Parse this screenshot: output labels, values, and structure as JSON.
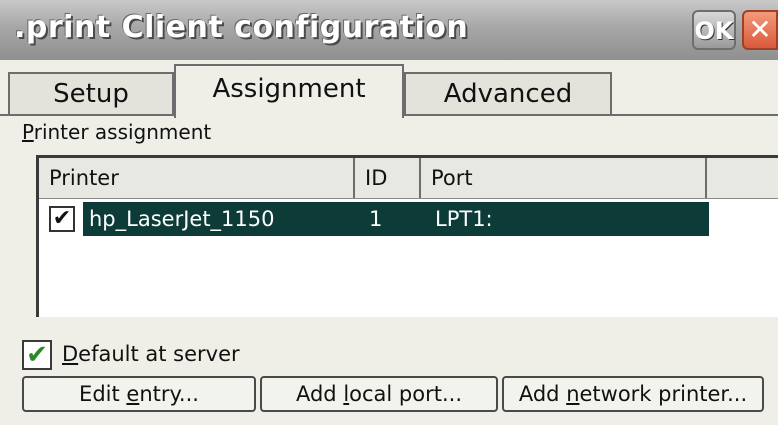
{
  "window": {
    "title": ".print Client configuration",
    "ok_label": "OK",
    "close_label": "✕"
  },
  "tabs": [
    {
      "label": "Setup"
    },
    {
      "label": "Assignment"
    },
    {
      "label": "Advanced"
    }
  ],
  "group": {
    "label_first": "P",
    "label_rest": "rinter assignment"
  },
  "table": {
    "columns": [
      "Printer",
      "ID",
      "Port"
    ],
    "rows": [
      {
        "checked": true,
        "check_glyph": "✔",
        "printer": "hp_LaserJet_1150",
        "id": "1",
        "port": "LPT1:"
      }
    ]
  },
  "default_at_server": {
    "checked": true,
    "check_glyph": "✔",
    "label_first": "D",
    "label_rest": "efault at server"
  },
  "buttons": {
    "edit_entry": {
      "before": "Edit ",
      "mnemonic": "e",
      "after": "ntry..."
    },
    "add_local_port": {
      "before": "Add ",
      "mnemonic": "l",
      "after": "ocal port..."
    },
    "add_network_printer": {
      "before": "Add ",
      "mnemonic": "n",
      "after": "etwork printer..."
    }
  }
}
